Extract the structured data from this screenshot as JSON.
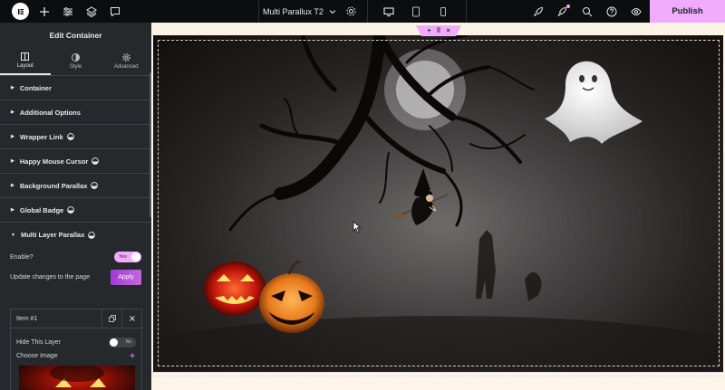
{
  "topbar": {
    "document_title": "Multi Parallux T2",
    "publish_label": "Publish",
    "left_icons": [
      "elementor-logo",
      "add-icon",
      "settings-sliders-icon",
      "layers-icon",
      "comments-icon"
    ],
    "devices": [
      "desktop",
      "tablet",
      "mobile"
    ],
    "active_device": "desktop",
    "right_icons": [
      "rocket-icon",
      "notes-icon",
      "search-icon",
      "help-icon",
      "preview-eye-icon"
    ],
    "accent_color": "#f0abfc"
  },
  "panel": {
    "title": "Edit Container",
    "tabs": [
      {
        "label": "Layout",
        "icon": "layout-icon",
        "active": true
      },
      {
        "label": "Style",
        "icon": "style-half-circle-icon",
        "active": false
      },
      {
        "label": "Advanced",
        "icon": "gear-icon",
        "active": false
      }
    ],
    "sections": [
      {
        "label": "Container",
        "happy": false
      },
      {
        "label": "Additional Options",
        "happy": false
      },
      {
        "label": "Wrapper Link",
        "happy": true
      },
      {
        "label": "Happy Mouse Cursor",
        "happy": true
      },
      {
        "label": "Background Parallax",
        "happy": true
      },
      {
        "label": "Global Badge",
        "happy": true
      }
    ],
    "open_section": {
      "label": "Multi Layer Parallax",
      "enable_label": "Enable?",
      "enable_value": "Yes",
      "update_label": "Update changes to the page",
      "apply_label": "Apply",
      "item": {
        "label": "Item #1",
        "hide_label": "Hide This Layer",
        "hide_value": "No",
        "choose_image_label": "Choose Image"
      }
    }
  },
  "canvas": {
    "scene": "halloween-parallax",
    "handle_icons": [
      "add-icon",
      "drag-grid-icon",
      "close-icon"
    ]
  }
}
